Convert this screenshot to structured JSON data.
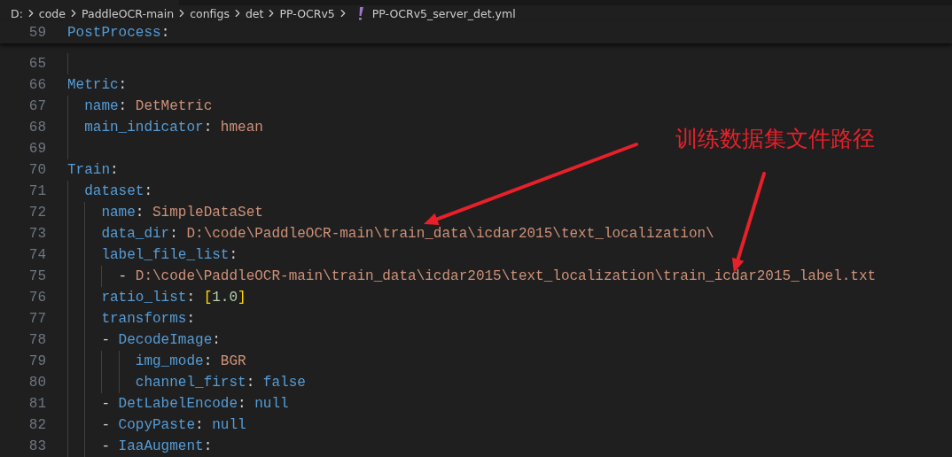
{
  "breadcrumb": [
    {
      "label": "D:",
      "kind": "folder"
    },
    {
      "label": "code",
      "kind": "folder"
    },
    {
      "label": "PaddleOCR-main",
      "kind": "folder"
    },
    {
      "label": "configs",
      "kind": "folder"
    },
    {
      "label": "det",
      "kind": "folder"
    },
    {
      "label": "PP-OCRv5",
      "kind": "folder"
    },
    {
      "label": "PP-OCRv5_server_det.yml",
      "kind": "file"
    }
  ],
  "sticky_line": {
    "number": "59",
    "tokens": [
      {
        "kind": "key",
        "text": "PostProcess"
      },
      {
        "kind": "punct",
        "text": ":"
      }
    ]
  },
  "lines": [
    {
      "number": "65"
    },
    {
      "number": "66",
      "tokens": [
        {
          "kind": "key",
          "text": "Metric"
        },
        {
          "kind": "punct",
          "text": ":"
        }
      ]
    },
    {
      "number": "67",
      "tokens": [
        {
          "kind": "key",
          "text": "  name"
        },
        {
          "kind": "punct",
          "text": ": "
        },
        {
          "kind": "string",
          "text": "DetMetric"
        }
      ]
    },
    {
      "number": "68",
      "tokens": [
        {
          "kind": "key",
          "text": "  main_indicator"
        },
        {
          "kind": "punct",
          "text": ": "
        },
        {
          "kind": "string",
          "text": "hmean"
        }
      ]
    },
    {
      "number": "69"
    },
    {
      "number": "70",
      "tokens": [
        {
          "kind": "key",
          "text": "Train"
        },
        {
          "kind": "punct",
          "text": ":"
        }
      ]
    },
    {
      "number": "71",
      "tokens": [
        {
          "kind": "key",
          "text": "  dataset"
        },
        {
          "kind": "punct",
          "text": ":"
        }
      ]
    },
    {
      "number": "72",
      "tokens": [
        {
          "kind": "key",
          "text": "    name"
        },
        {
          "kind": "punct",
          "text": ": "
        },
        {
          "kind": "string",
          "text": "SimpleDataSet"
        }
      ]
    },
    {
      "number": "73",
      "tokens": [
        {
          "kind": "key",
          "text": "    data_dir"
        },
        {
          "kind": "punct",
          "text": ": "
        },
        {
          "kind": "string",
          "text": "D:\\code\\PaddleOCR-main\\train_data\\icdar2015\\text_localization\\"
        }
      ]
    },
    {
      "number": "74",
      "tokens": [
        {
          "kind": "key",
          "text": "    label_file_list"
        },
        {
          "kind": "punct",
          "text": ":"
        }
      ]
    },
    {
      "number": "75",
      "tokens": [
        {
          "kind": "punct",
          "text": "      - "
        },
        {
          "kind": "string",
          "text": "D:\\code\\PaddleOCR-main\\train_data\\icdar2015\\text_localization\\train_icdar2015_label.txt"
        }
      ]
    },
    {
      "number": "76",
      "tokens": [
        {
          "kind": "key",
          "text": "    ratio_list"
        },
        {
          "kind": "punct",
          "text": ": "
        },
        {
          "kind": "bracket",
          "text": "["
        },
        {
          "kind": "number",
          "text": "1.0"
        },
        {
          "kind": "bracket",
          "text": "]"
        }
      ]
    },
    {
      "number": "77",
      "tokens": [
        {
          "kind": "key",
          "text": "    transforms"
        },
        {
          "kind": "punct",
          "text": ":"
        }
      ]
    },
    {
      "number": "78",
      "tokens": [
        {
          "kind": "punct",
          "text": "    - "
        },
        {
          "kind": "key",
          "text": "DecodeImage"
        },
        {
          "kind": "punct",
          "text": ":"
        }
      ]
    },
    {
      "number": "79",
      "tokens": [
        {
          "kind": "key",
          "text": "        img_mode"
        },
        {
          "kind": "punct",
          "text": ": "
        },
        {
          "kind": "string",
          "text": "BGR"
        }
      ]
    },
    {
      "number": "80",
      "tokens": [
        {
          "kind": "key",
          "text": "        channel_first"
        },
        {
          "kind": "punct",
          "text": ": "
        },
        {
          "kind": "keyword",
          "text": "false"
        }
      ]
    },
    {
      "number": "81",
      "tokens": [
        {
          "kind": "punct",
          "text": "    - "
        },
        {
          "kind": "key",
          "text": "DetLabelEncode"
        },
        {
          "kind": "punct",
          "text": ": "
        },
        {
          "kind": "keyword",
          "text": "null"
        }
      ]
    },
    {
      "number": "82",
      "tokens": [
        {
          "kind": "punct",
          "text": "    - "
        },
        {
          "kind": "key",
          "text": "CopyPaste"
        },
        {
          "kind": "punct",
          "text": ": "
        },
        {
          "kind": "keyword",
          "text": "null"
        }
      ]
    },
    {
      "number": "83",
      "tokens": [
        {
          "kind": "punct",
          "text": "    - "
        },
        {
          "kind": "key",
          "text": "IaaAugment"
        },
        {
          "kind": "punct",
          "text": ":"
        }
      ]
    }
  ],
  "annotation": {
    "text": "训练数据集文件路径"
  }
}
